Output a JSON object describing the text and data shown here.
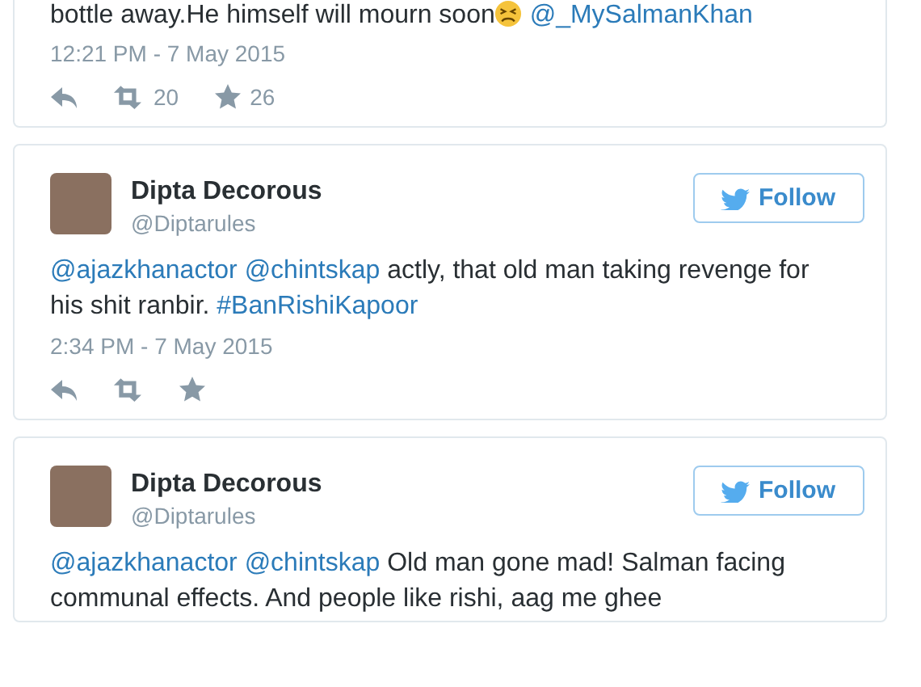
{
  "tweets": [
    {
      "text": [
        {
          "kind": "text",
          "text": "bottle away.He himself will mourn soon"
        },
        {
          "kind": "emoji"
        },
        {
          "kind": "space"
        },
        {
          "kind": "link",
          "text": "@_MySalmanKhan"
        }
      ],
      "time": "12:21 PM - 7 May 2015",
      "retweets": "20",
      "favorites": "26"
    },
    {
      "author": {
        "name": "Dipta Decorous",
        "handle": "@Diptarules",
        "follow": "Follow"
      },
      "text": [
        {
          "kind": "link",
          "text": "@ajazkhanactor"
        },
        {
          "kind": "space"
        },
        {
          "kind": "link",
          "text": "@chintskap"
        },
        {
          "kind": "text",
          "text": " actly, that old man taking revenge for his shit ranbir. "
        },
        {
          "kind": "link",
          "text": "#BanRishiKapoor"
        }
      ],
      "time": "2:34 PM - 7 May 2015"
    },
    {
      "author": {
        "name": "Dipta Decorous",
        "handle": "@Diptarules",
        "follow": "Follow"
      },
      "text": [
        {
          "kind": "link",
          "text": "@ajazkhanactor"
        },
        {
          "kind": "space"
        },
        {
          "kind": "link",
          "text": "@chintskap"
        },
        {
          "kind": "text",
          "text": " Old man gone mad!  Salman facing communal effects. And  people like rishi, aag me ghee"
        }
      ]
    }
  ]
}
